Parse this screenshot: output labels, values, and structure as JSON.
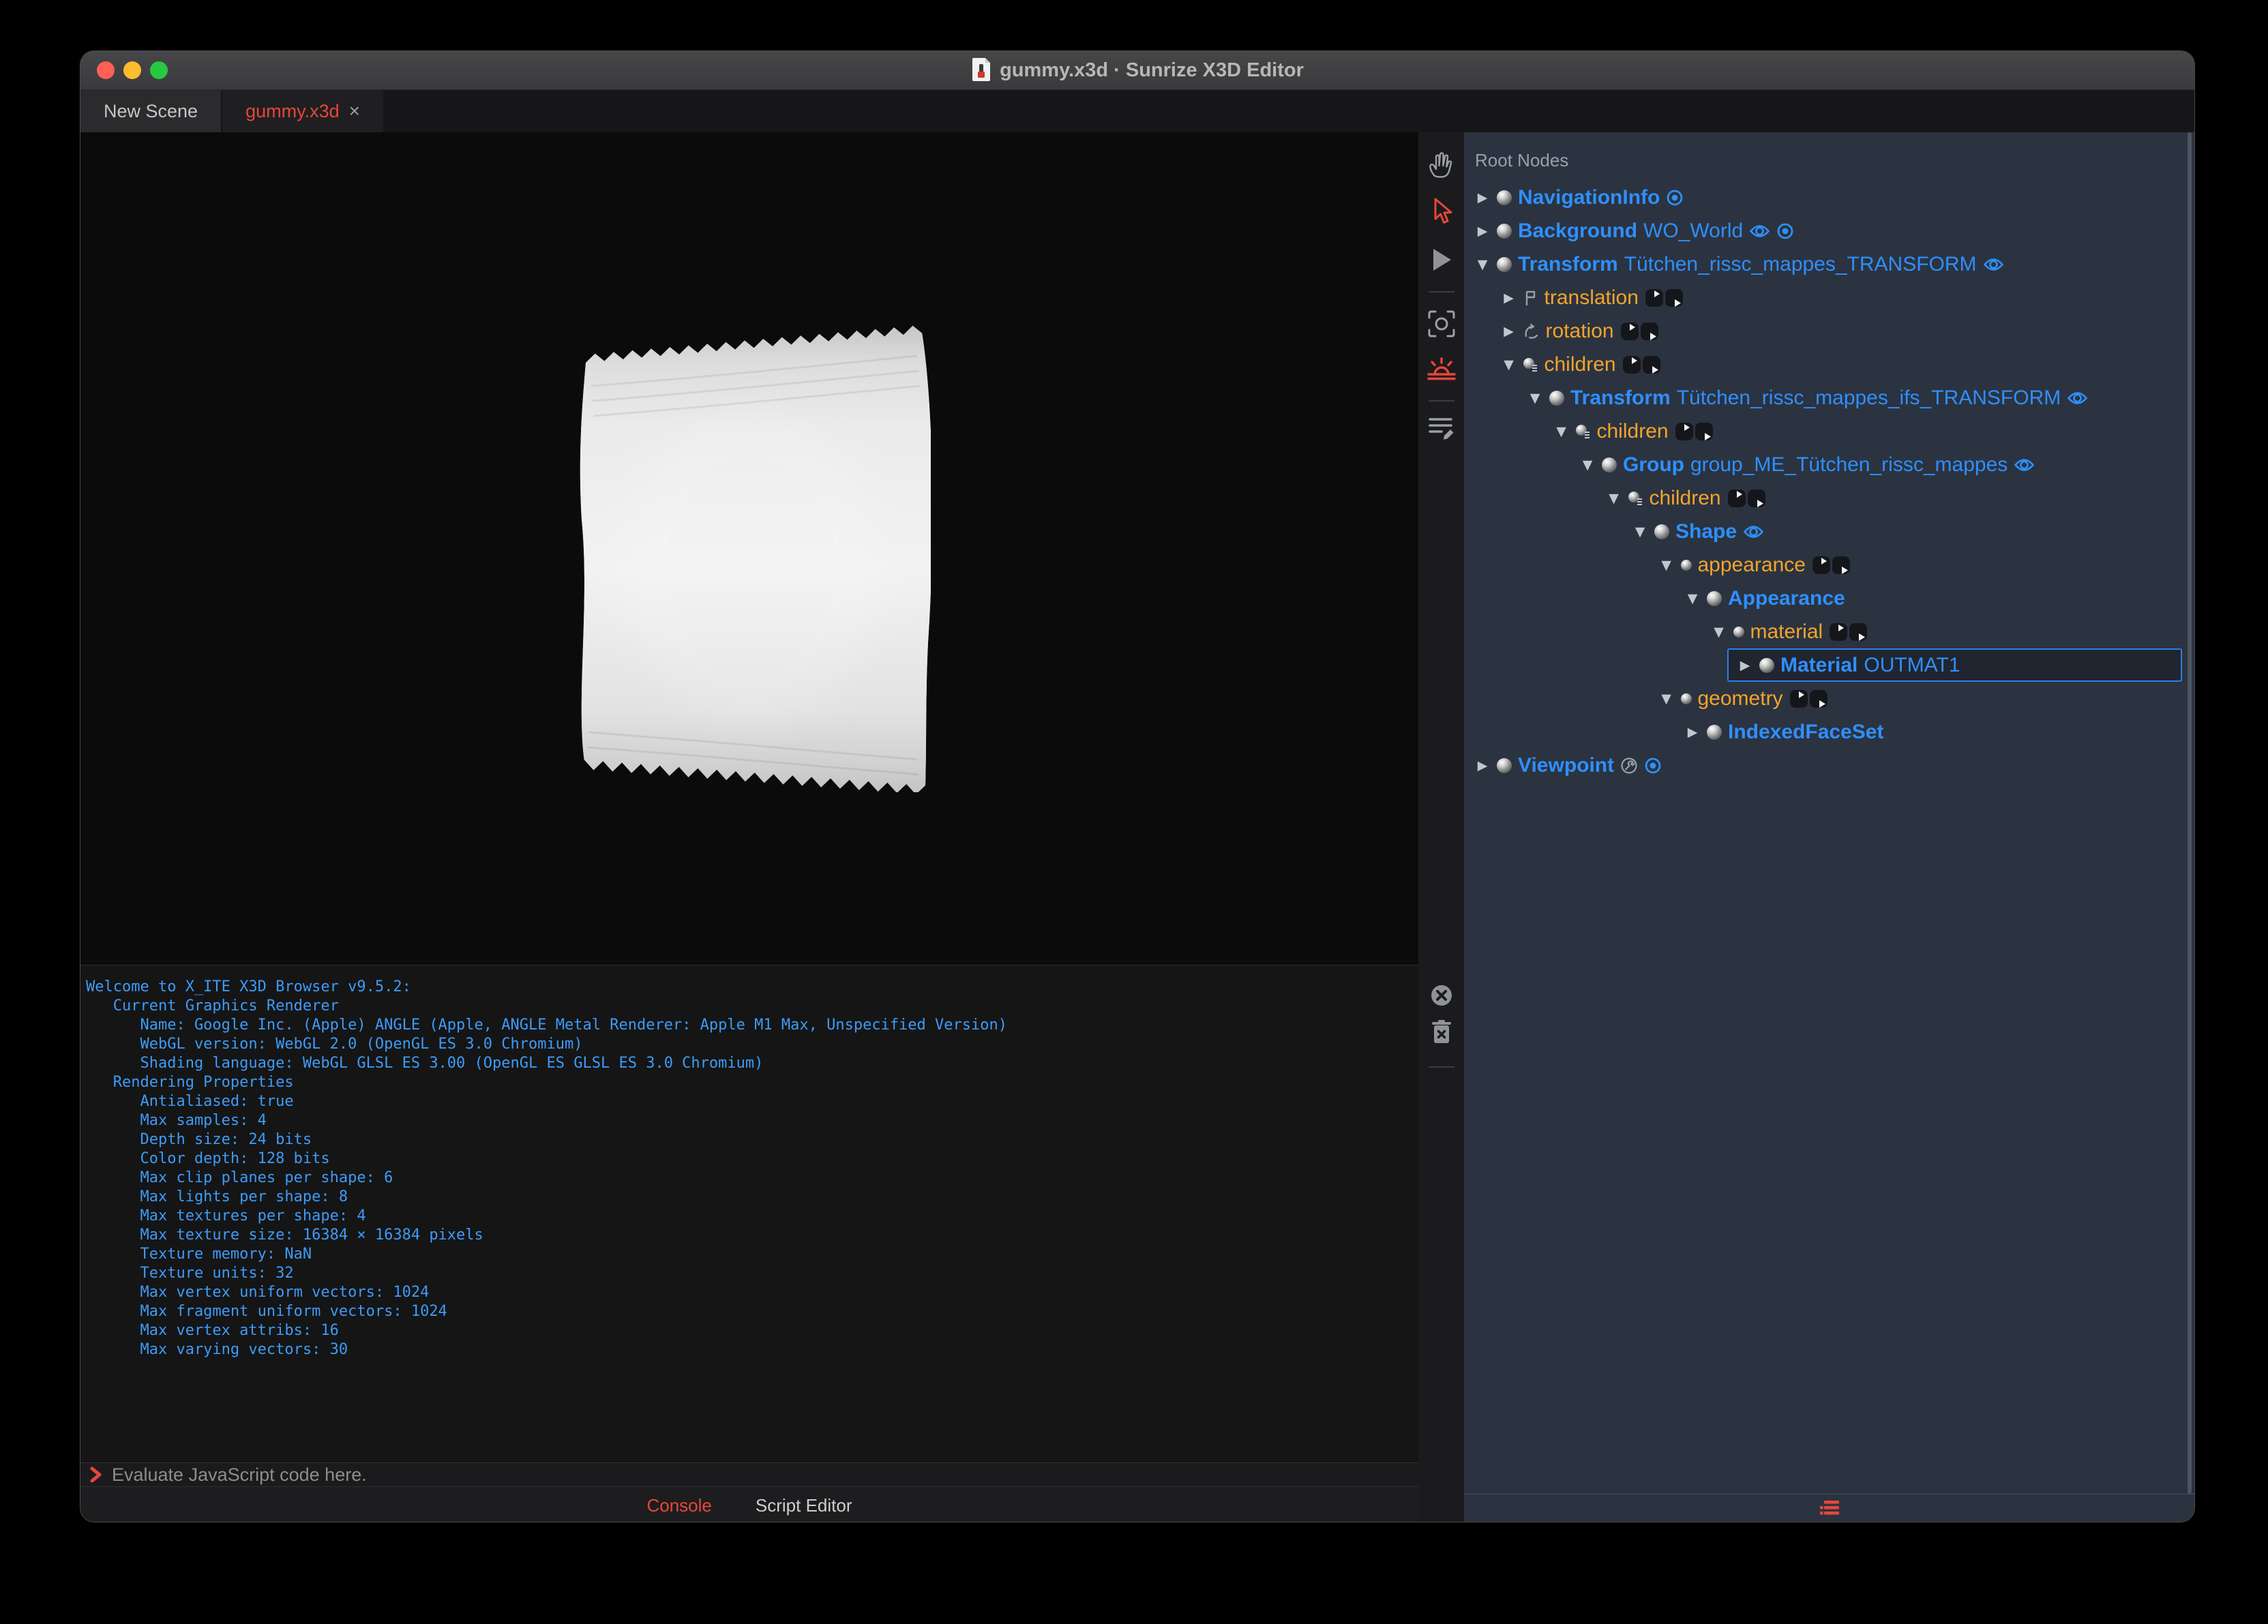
{
  "window": {
    "title": "gummy.x3d · Sunrize X3D Editor"
  },
  "tabs": [
    {
      "label": "New Scene",
      "active": false
    },
    {
      "label": "gummy.x3d",
      "close": "×",
      "active": true
    }
  ],
  "toolbar": {
    "icons": [
      "hand-pan-tool",
      "arrow-select-tool",
      "play-button",
      "snapshot-viewpoint",
      "environment-light",
      "script-notes"
    ],
    "console_icons": [
      "clear-console",
      "delete-console"
    ]
  },
  "outline": {
    "header": "Root Nodes",
    "rows": [
      {
        "depth": 0,
        "expanded": false,
        "icon": "node",
        "type": "NavigationInfo",
        "def": "",
        "badges": [
          "bound"
        ],
        "selected": false
      },
      {
        "depth": 0,
        "expanded": false,
        "icon": "node",
        "type": "Background",
        "def": "WO_World",
        "badges": [
          "eye",
          "bound"
        ],
        "selected": false
      },
      {
        "depth": 0,
        "expanded": true,
        "icon": "node",
        "type": "Transform",
        "def": "Tütchen_rissc_mappes_TRANSFORM",
        "badges": [
          "eye"
        ],
        "selected": false
      },
      {
        "depth": 1,
        "expanded": false,
        "icon": "translation",
        "field": "translation",
        "connectors": true
      },
      {
        "depth": 1,
        "expanded": false,
        "icon": "rotation",
        "field": "rotation",
        "connectors": true
      },
      {
        "depth": 1,
        "expanded": true,
        "icon": "mfnode",
        "field": "children",
        "connectors": true
      },
      {
        "depth": 2,
        "expanded": true,
        "icon": "node",
        "type": "Transform",
        "def": "Tütchen_rissc_mappes_ifs_TRANSFORM",
        "badges": [
          "eye"
        ],
        "selected": false
      },
      {
        "depth": 3,
        "expanded": true,
        "icon": "mfnode",
        "field": "children",
        "connectors": true
      },
      {
        "depth": 4,
        "expanded": true,
        "icon": "node",
        "type": "Group",
        "def": "group_ME_Tütchen_rissc_mappes",
        "badges": [
          "eye"
        ],
        "selected": false
      },
      {
        "depth": 5,
        "expanded": true,
        "icon": "mfnode",
        "field": "children",
        "connectors": true
      },
      {
        "depth": 6,
        "expanded": true,
        "icon": "node",
        "type": "Shape",
        "def": "",
        "badges": [
          "eye"
        ],
        "selected": false
      },
      {
        "depth": 7,
        "expanded": true,
        "icon": "sfnode",
        "field": "appearance",
        "connectors": true
      },
      {
        "depth": 8,
        "expanded": true,
        "icon": "node",
        "type": "Appearance",
        "def": "",
        "badges": [],
        "selected": false
      },
      {
        "depth": 9,
        "expanded": true,
        "icon": "sfnode",
        "field": "material",
        "connectors": true
      },
      {
        "depth": 10,
        "expanded": false,
        "icon": "node",
        "type": "Material",
        "def": "OUTMAT1",
        "badges": [],
        "selected": true
      },
      {
        "depth": 7,
        "expanded": true,
        "icon": "sfnode",
        "field": "geometry",
        "connectors": true
      },
      {
        "depth": 8,
        "expanded": false,
        "icon": "node",
        "type": "IndexedFaceSet",
        "def": "",
        "badges": [],
        "selected": false
      },
      {
        "depth": 0,
        "expanded": false,
        "icon": "node",
        "type": "Viewpoint",
        "def": "",
        "badges": [
          "wrench",
          "bound"
        ],
        "selected": false
      }
    ]
  },
  "console": {
    "lines": [
      "Welcome to X_ITE X3D Browser v9.5.2:",
      "   Current Graphics Renderer",
      "      Name: Google Inc. (Apple) ANGLE (Apple, ANGLE Metal Renderer: Apple M1 Max, Unspecified Version)",
      "      WebGL version: WebGL 2.0 (OpenGL ES 3.0 Chromium)",
      "      Shading language: WebGL GLSL ES 3.00 (OpenGL ES GLSL ES 3.0 Chromium)",
      "   Rendering Properties",
      "      Antialiased: true",
      "      Max samples: 4",
      "      Depth size: 24 bits",
      "      Color depth: 128 bits",
      "      Max clip planes per shape: 6",
      "      Max lights per shape: 8",
      "      Max textures per shape: 4",
      "      Max texture size: 16384 × 16384 pixels",
      "      Texture memory: NaN",
      "      Texture units: 32",
      "      Max vertex uniform vectors: 1024",
      "      Max fragment uniform vectors: 1024",
      "      Max vertex attribs: 16",
      "      Max varying vectors: 30"
    ],
    "prompt_placeholder": "Evaluate JavaScript code here."
  },
  "footer": {
    "tabs": [
      {
        "label": "Console",
        "active": true
      },
      {
        "label": "Script Editor",
        "active": false
      }
    ]
  },
  "colors": {
    "accent_red": "#e8463c",
    "node_blue": "#2f8fff",
    "field_orange": "#f3a42c",
    "panel_bg": "#2b3340",
    "console_text": "#3d9bf8"
  }
}
